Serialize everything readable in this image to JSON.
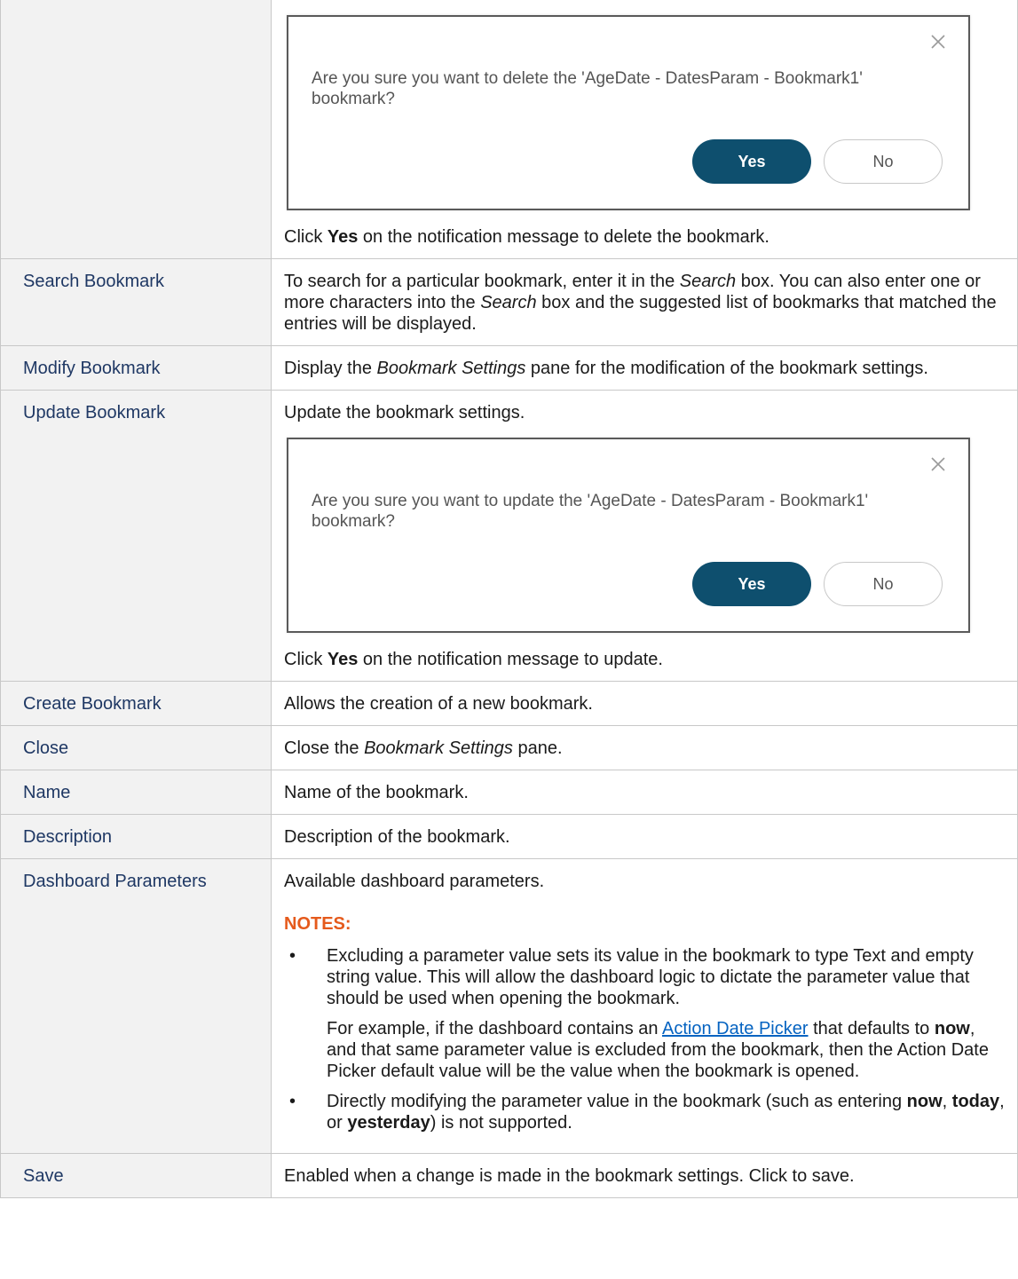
{
  "rows": {
    "delete": {
      "dialog": {
        "message": "Are you sure you want to delete the 'AgeDate - DatesParam - Bookmark1' bookmark?",
        "yes": "Yes",
        "no": "No"
      },
      "after_pre": "Click ",
      "after_bold": "Yes",
      "after_post": " on the notification message to delete the bookmark."
    },
    "search": {
      "label": "Search Bookmark",
      "t1": "To search for a particular bookmark, enter it in the ",
      "i1": "Search",
      "t2": " box. You can also enter one or more characters into the ",
      "i2": "Search",
      "t3": " box and the suggested list of bookmarks that matched the entries will be displayed."
    },
    "modify": {
      "label": "Modify Bookmark",
      "t1": "Display the ",
      "i1": "Bookmark Settings",
      "t2": " pane for the modification of the bookmark settings."
    },
    "update": {
      "label": "Update Bookmark",
      "text": "Update the bookmark settings.",
      "dialog": {
        "message": "Are you sure you want to update the 'AgeDate - DatesParam - Bookmark1' bookmark?",
        "yes": "Yes",
        "no": "No"
      },
      "after_pre": "Click ",
      "after_bold": "Yes",
      "after_post": " on the notification message to update."
    },
    "create": {
      "label": "Create Bookmark",
      "text": "Allows the creation of a new bookmark."
    },
    "close": {
      "label": "Close",
      "t1": "Close the ",
      "i1": "Bookmark Settings",
      "t2": " pane."
    },
    "name": {
      "label": "Name",
      "text": "Name of the bookmark."
    },
    "description": {
      "label": "Description",
      "text": "Description of the bookmark."
    },
    "params": {
      "label": "Dashboard Parameters",
      "text": "Available dashboard parameters.",
      "notes_heading": "NOTES:",
      "note1_p1": "Excluding a parameter value sets its value in the bookmark to type Text and empty string value. This will allow the dashboard logic to dictate the parameter value that should be used when opening the bookmark.",
      "note1_p2_a": "For example, if the dashboard contains an ",
      "note1_p2_link": "Action Date Picker",
      "note1_p2_b": " that defaults to ",
      "note1_p2_bold": "now",
      "note1_p2_c": ", and that same parameter value is excluded from the bookmark, then the Action Date Picker default value will be the value when the bookmark is opened.",
      "note2_a": "Directly modifying the parameter value in the bookmark (such as entering ",
      "note2_b1": "now",
      "note2_sep1": ", ",
      "note2_b2": "today",
      "note2_sep2": ", or ",
      "note2_b3": "yesterday",
      "note2_c": ") is not supported."
    },
    "save": {
      "label": "Save",
      "text": "Enabled when a change is made in the bookmark settings. Click to save."
    }
  }
}
